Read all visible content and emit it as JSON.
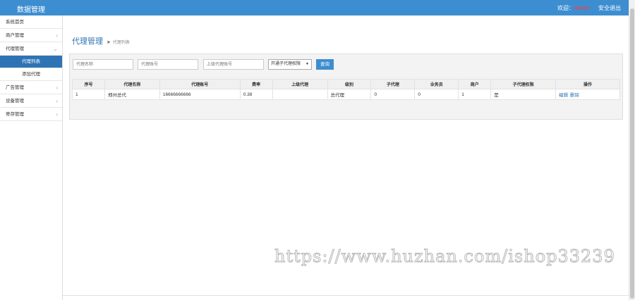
{
  "header": {
    "brand": "数据管理",
    "welcome": "欢迎：",
    "username": "admin",
    "logout": "安全退出"
  },
  "sidebar": {
    "items": [
      {
        "label": "系统首页"
      },
      {
        "label": "商户管理"
      },
      {
        "label": "代理管理"
      },
      {
        "label": "广告管理"
      },
      {
        "label": "设备管理"
      },
      {
        "label": "寄存管理"
      }
    ],
    "sub": [
      {
        "label": "代理列表"
      },
      {
        "label": "添加代理"
      }
    ]
  },
  "page": {
    "title": "代理管理",
    "crumb": "代理列表"
  },
  "filters": {
    "name_placeholder": "代理名称",
    "account_placeholder": "代理账号",
    "parent_placeholder": "上级代理账号",
    "select_value": "开通子代理权限",
    "search_label": "查询"
  },
  "table": {
    "headers": [
      "序号",
      "代理名称",
      "代理账号",
      "费率",
      "上级代理",
      "级别",
      "子代理",
      "业务员",
      "商户",
      "子代理权限",
      "操作"
    ],
    "rows": [
      {
        "no": "1",
        "name": "郑州总代",
        "account": "16666666666",
        "rate": "0.38",
        "parent": "",
        "level": "总代理",
        "sub_agents": "0",
        "salesmen": "0",
        "merchants": "1",
        "permission": "是",
        "edit": "编辑",
        "delete": "删除"
      }
    ]
  },
  "watermark": "https://www.huzhan.com/ishop33239",
  "colors": {
    "header_bg": "#3d8ed0",
    "active_nav": "#2e74b5",
    "username": "#ff3b3b",
    "link": "#2e74b5"
  }
}
